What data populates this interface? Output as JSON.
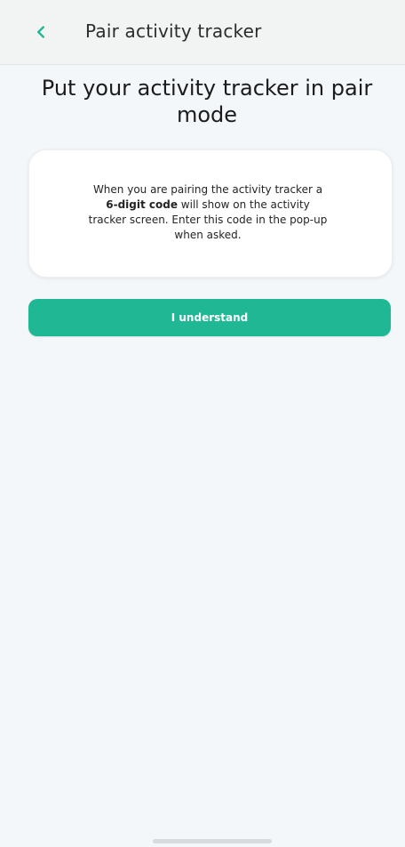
{
  "header": {
    "title": "Pair activity tracker",
    "corner_note_line1": "",
    "corner_note_line2": ""
  },
  "main": {
    "headline": "Put your activity tracker in pair mode",
    "info_card": {
      "text_before_bold": "When you are pairing the activity tracker a ",
      "bold_text": "6-digit code",
      "text_after_bold": " will show on the activity tracker screen. Enter this code in the pop-up when asked."
    },
    "primary_button_label": "I understand"
  },
  "icons": {
    "back": "chevron-left-icon"
  },
  "colors": {
    "accent": "#20b894",
    "background": "#f3f7fa",
    "card": "#ffffff"
  }
}
